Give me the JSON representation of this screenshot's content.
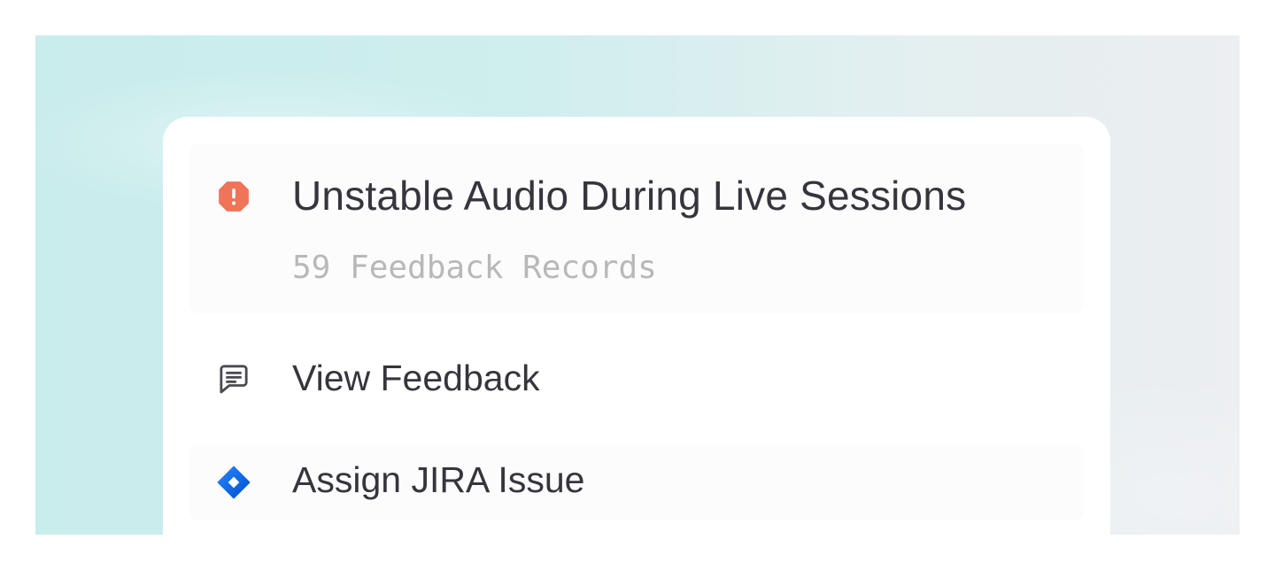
{
  "issue": {
    "title": "Unstable Audio During Live Sessions",
    "record_count_label": "59 Feedback Records",
    "status_icon": "alert-octagon-icon",
    "status_color": "#ef7458"
  },
  "actions": [
    {
      "label": "View Feedback",
      "icon": "message-square-icon",
      "icon_color": "#4a4a52"
    },
    {
      "label": "Assign JIRA Issue",
      "icon": "jira-icon",
      "icon_color": "#2684ff"
    }
  ],
  "colors": {
    "background_left": "#c9ecec",
    "background_right": "#eceef1",
    "card": "#ffffff",
    "text_primary": "#35353d",
    "text_muted": "#b8b8b8"
  }
}
